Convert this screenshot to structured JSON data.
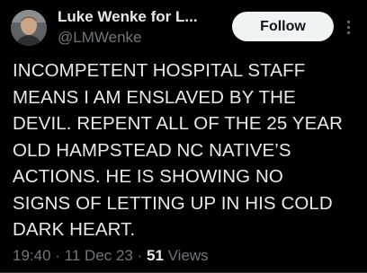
{
  "author": {
    "display_name": "Luke Wenke for L...",
    "handle": "@LMWenke",
    "avatar_icon": "user-avatar"
  },
  "actions": {
    "follow_label": "Follow",
    "more_icon": "more-vertical-icon"
  },
  "tweet": {
    "lines": [
      "INCOMPETENT HOSPITAL STAFF",
      "MEANS I AM ENSLAVED BY THE",
      "DEVIL.  REPENT ALL OF THE 25 YEAR",
      "OLD HAMPSTEAD NC NATIVE’S",
      "ACTIONS.  HE IS SHOWING NO",
      "SIGNS OF LETTING UP IN HIS COLD",
      "DARK HEART."
    ]
  },
  "meta": {
    "time": "19:40",
    "separator": " · ",
    "date": "11 Dec 23",
    "views_count": "51",
    "views_label": " Views"
  },
  "colors": {
    "background": "#000000",
    "primary_text": "#e7e9ea",
    "secondary_text": "#71767b",
    "follow_bg": "#eff3f4",
    "follow_text": "#0f1419"
  }
}
